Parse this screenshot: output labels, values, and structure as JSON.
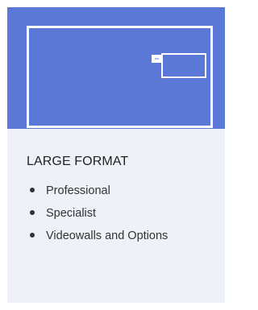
{
  "card": {
    "title": "LARGE FORMAT",
    "hero": {
      "tag": "on",
      "colors": {
        "background": "#5c78d6",
        "outline": "#ffffff"
      }
    },
    "features": [
      {
        "label": "Professional"
      },
      {
        "label": "Specialist"
      },
      {
        "label": "Videowalls and Options"
      }
    ]
  }
}
